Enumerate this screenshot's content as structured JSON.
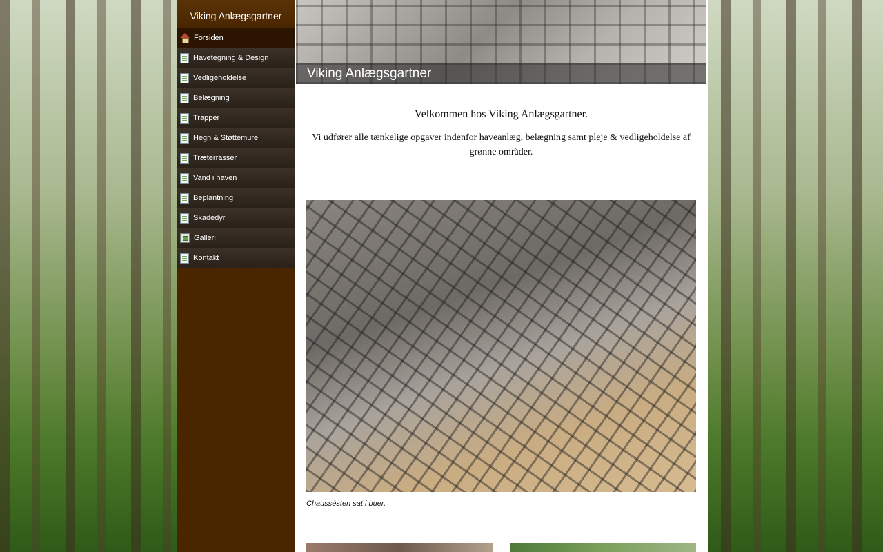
{
  "sidebar": {
    "site_name": "Viking Anlægsgartner",
    "items": [
      {
        "label": "Forsiden",
        "icon": "home-icon"
      },
      {
        "label": "Havetegning & Design",
        "icon": "page-icon"
      },
      {
        "label": "Vedligeholdelse",
        "icon": "page-icon"
      },
      {
        "label": "Belægning",
        "icon": "page-icon"
      },
      {
        "label": "Trapper",
        "icon": "page-icon"
      },
      {
        "label": "Hegn & Støttemure",
        "icon": "page-icon"
      },
      {
        "label": "Træterrasser",
        "icon": "page-icon"
      },
      {
        "label": "Vand i haven",
        "icon": "page-icon"
      },
      {
        "label": "Beplantning",
        "icon": "page-icon"
      },
      {
        "label": "Skadedyr",
        "icon": "page-icon"
      },
      {
        "label": "Galleri",
        "icon": "gallery-icon"
      },
      {
        "label": "Kontakt",
        "icon": "page-icon"
      }
    ]
  },
  "header": {
    "title": "Viking Anlægsgartner"
  },
  "main": {
    "welcome": "Velkommen hos Viking Anlægsgartner.",
    "intro": "Vi udfører alle tænkelige opgaver indenfor haveanlæg, belægning samt pleje & vedligeholdelse af grønne områder.",
    "caption": "Chaussésten sat i buer."
  },
  "colors": {
    "sidebar_bg": "#4a2600",
    "nav_item_bg": "#2f261d",
    "page_bg": "#ffffff"
  }
}
